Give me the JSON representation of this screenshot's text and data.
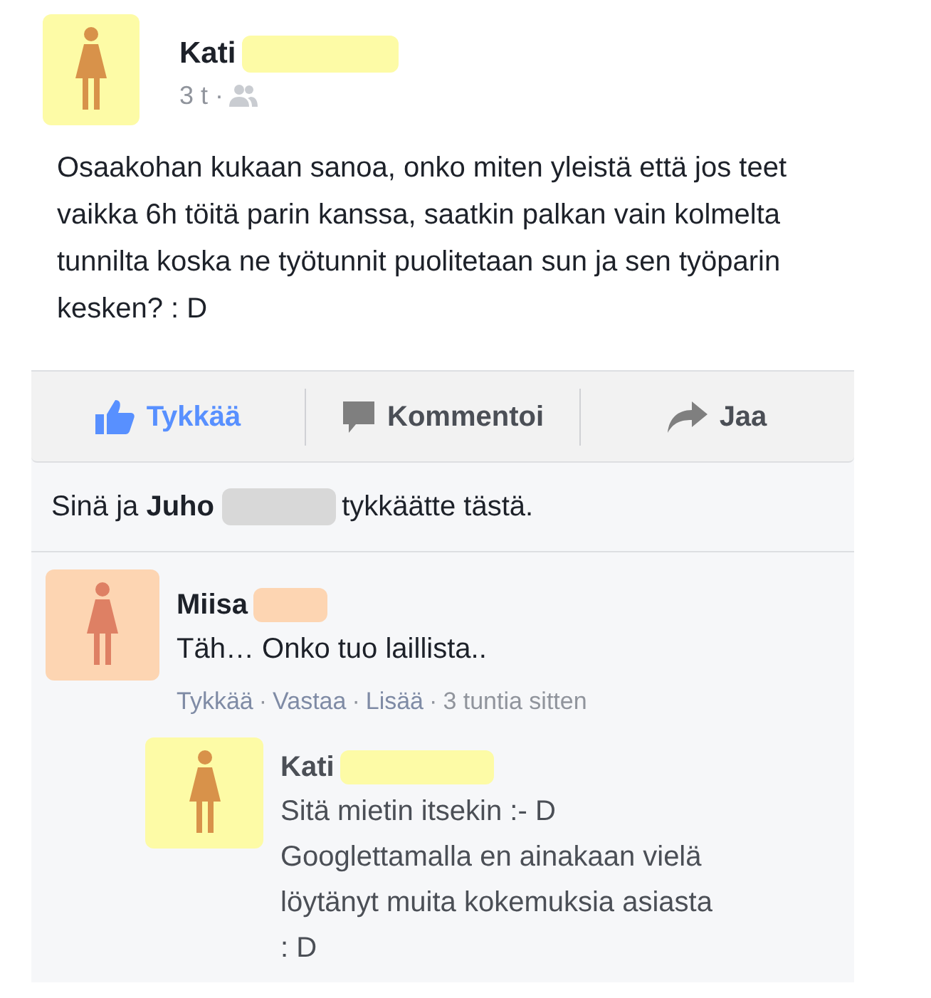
{
  "post": {
    "author": "Kati",
    "time": "3 t ·",
    "text": "Osaakohan kukaan sanoa, onko miten yleistä että jos teet vaikka 6h töitä parin kanssa, saatkin palkan vain kolmelta tunnilta koska ne työtunnit puolitetaan sun ja sen työparin kesken? : D"
  },
  "actions": [
    {
      "label": "Tykkää",
      "kind": "like",
      "selected": true
    },
    {
      "label": "Kommentoi",
      "kind": "comment",
      "selected": false
    },
    {
      "label": "Jaa",
      "kind": "share",
      "selected": false
    }
  ],
  "likes": "Sinä ja **Juho** ",
  "likes_end": "tykkäätte tästä.",
  "comments": [
    {
      "author": "Miisa",
      "color": "#fdd5b2",
      "text": "Täh… Onko tuo laillista..",
      "links": [
        "Tykkää",
        "Vastaa",
        "Lisää"
      ],
      "separator": "·",
      "time": "3 tuntia sitten",
      "children": [
        {
          "author": "Kati",
          "color": "#fdfba6",
          "text": "Sitä mietin itsekin :- D\nGooglettamalla en ainakaan vielä löytänyt muita kokemuksia asiasta : D"
        }
      ]
    }
  ]
}
